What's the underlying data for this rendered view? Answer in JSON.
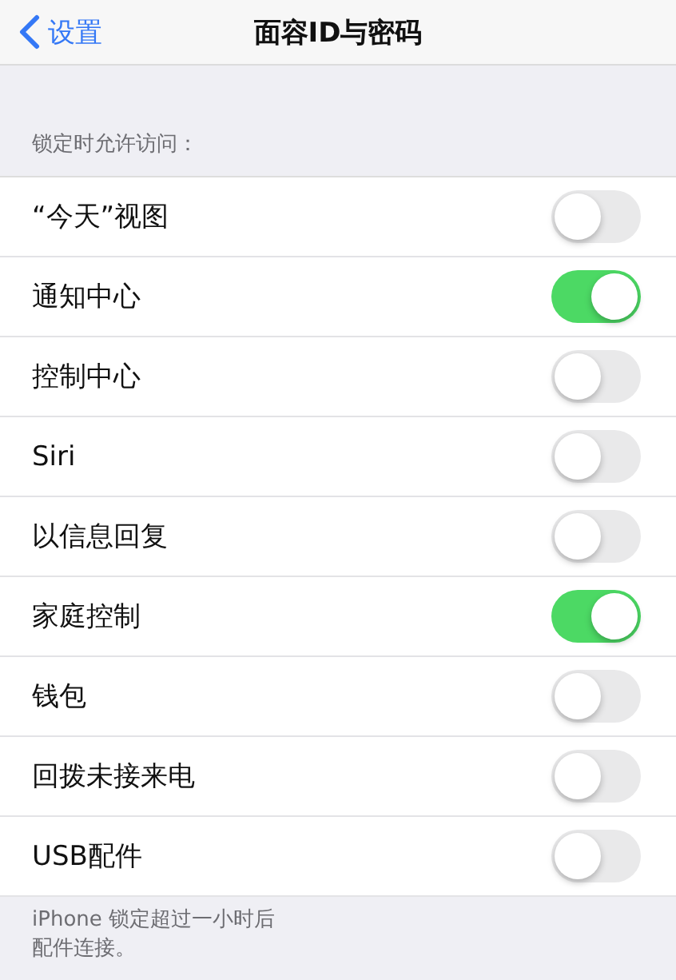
{
  "nav": {
    "back": "设置",
    "title": "面容ID与密码"
  },
  "section_header": "锁定时允许访问：",
  "rows": [
    {
      "label": "“今天”视图",
      "on": false
    },
    {
      "label": "通知中心",
      "on": true
    },
    {
      "label": "控制中心",
      "on": false
    },
    {
      "label": "Siri",
      "on": false
    },
    {
      "label": "以信息回复",
      "on": false
    },
    {
      "label": "家庭控制",
      "on": true
    },
    {
      "label": "钱包",
      "on": false
    },
    {
      "label": "回拨未接来电",
      "on": false
    },
    {
      "label": "USB配件",
      "on": false
    }
  ],
  "footer_lines": [
    "iPhone 锁定超过一小时后",
    "配件连接。"
  ]
}
